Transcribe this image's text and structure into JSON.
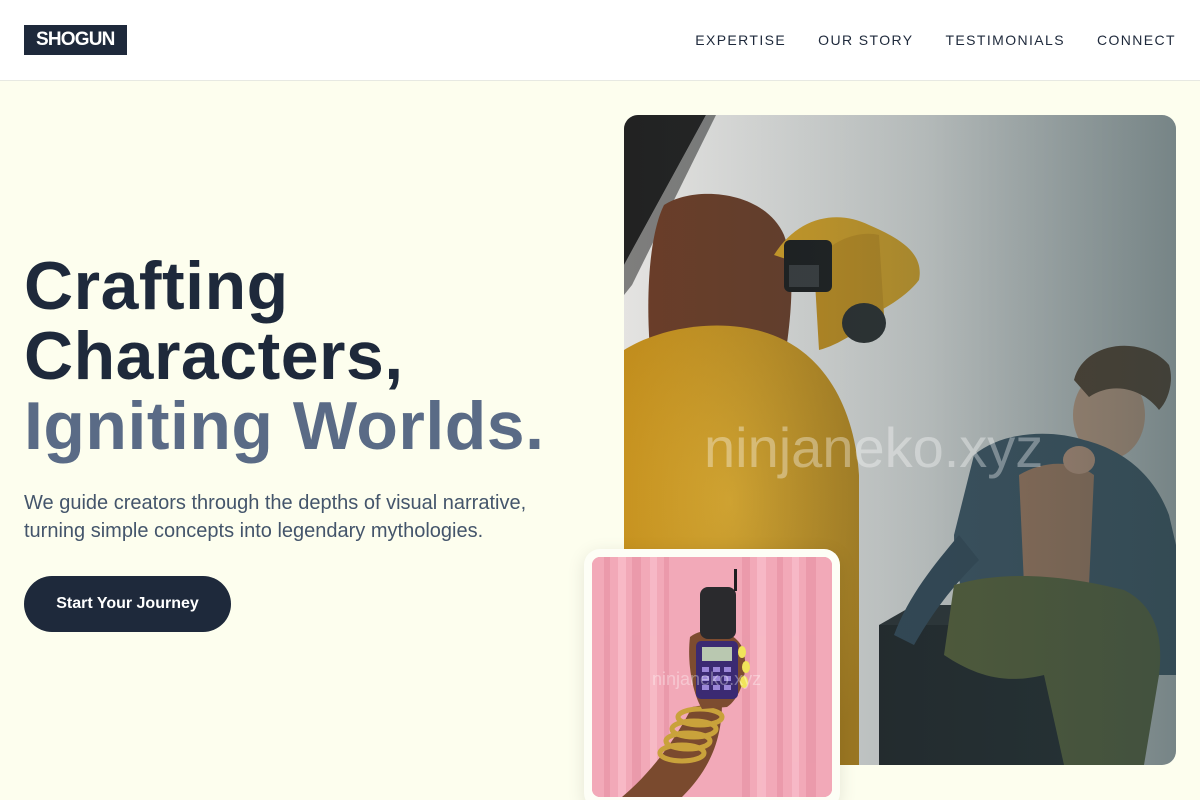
{
  "header": {
    "logo": "SHOGUN",
    "nav": [
      "EXPERTISE",
      "OUR STORY",
      "TESTIMONIALS",
      "CONNECT"
    ]
  },
  "hero": {
    "headline_line1": "Crafting",
    "headline_line2": "Characters,",
    "headline_line3": "Igniting Worlds.",
    "subtitle": "We guide creators through the depths of visual narrative, turning simple concepts into legendary mythologies.",
    "cta": "Start Your Journey"
  },
  "images": {
    "main_watermark": "ninjaneko.xyz",
    "small_watermark": "ninjaneko.xyz"
  },
  "colors": {
    "primary": "#1e293b",
    "accent_muted": "#5a6b86",
    "background": "#fdfeee"
  }
}
